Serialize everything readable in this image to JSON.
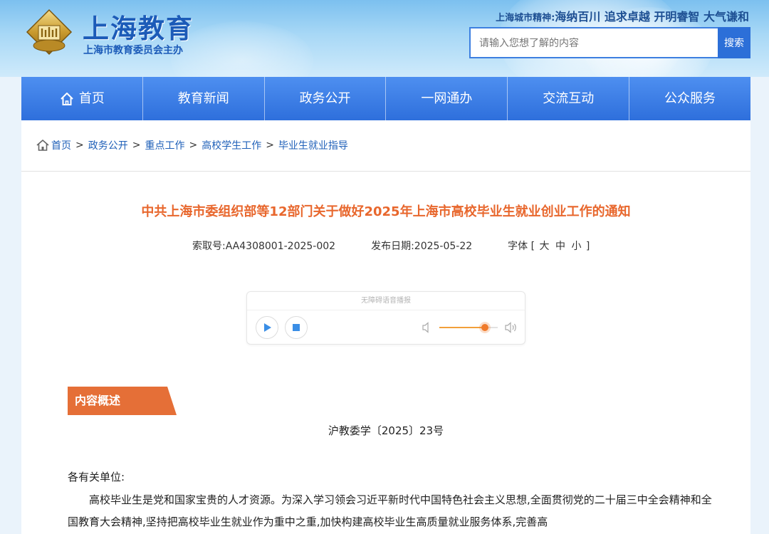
{
  "site": {
    "title": "上海教育",
    "subtitle": "上海市教育委员会主办",
    "spirit_label": "上海城市精神:",
    "spirit_text": "海纳百川 追求卓越 开明睿智 大气谦和"
  },
  "search": {
    "placeholder": "请输入您想了解的内容",
    "button_label": "搜索"
  },
  "nav": {
    "items": [
      {
        "label": "首页"
      },
      {
        "label": "教育新闻"
      },
      {
        "label": "政务公开"
      },
      {
        "label": "一网通办"
      },
      {
        "label": "交流互动"
      },
      {
        "label": "公众服务"
      }
    ]
  },
  "breadcrumb": {
    "items": [
      "首页",
      "政务公开",
      "重点工作",
      "高校学生工作",
      "毕业生就业指导"
    ],
    "separator": ">"
  },
  "article": {
    "title": "中共上海市委组织部等12部门关于做好2025年上海市高校毕业生就业创业工作的通知",
    "index_label": "索取号:",
    "index_value": "AA4308001-2025-002",
    "date_label": "发布日期:",
    "date_value": "2025-05-22",
    "font_label": "字体 [",
    "font_large": "大",
    "font_medium": "中",
    "font_small": "小",
    "font_close": "]"
  },
  "player": {
    "title": "无障碍语音播报",
    "volume": 0.78
  },
  "summary": {
    "tab_label": "内容概述",
    "doc_number": "沪教委学〔2025〕23号",
    "salutation": "各有关单位:",
    "body": "高校毕业生是党和国家宝贵的人才资源。为深入学习领会习近平新时代中国特色社会主义思想,全面贯彻党的二十届三中全会精神和全国教育大会精神,坚持把高校毕业生就业作为重中之重,加快构建高校毕业生高质量就业服务体系,完善高"
  },
  "colors": {
    "nav": "#2e6fdc",
    "title": "#e8672d",
    "tab": "#e56f37",
    "link": "#1e5fb8"
  }
}
